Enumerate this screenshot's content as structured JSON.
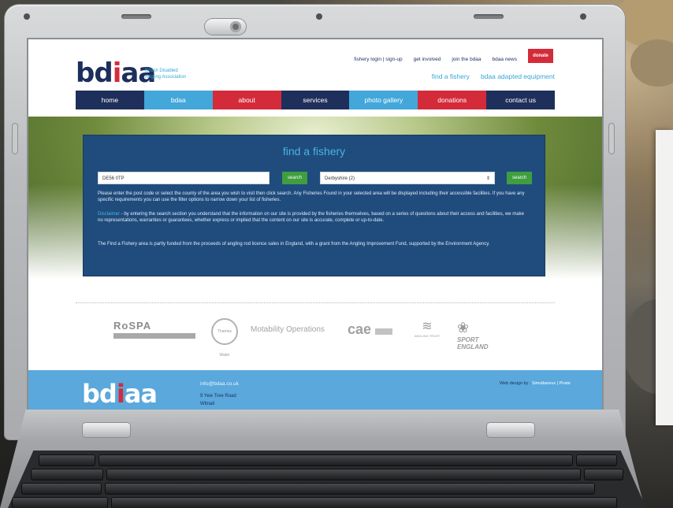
{
  "site": {
    "logo_text_pre": "bd",
    "logo_text_dot": "i",
    "logo_text_post": "aa",
    "logo_subtitle_1": "British Disabled",
    "logo_subtitle_2": "Angling Association",
    "top_links": [
      "fishery login | sign-up",
      "get involved",
      "join the bdaa",
      "bdaa news"
    ],
    "donate_label": "donate",
    "sub_links": [
      "find a fishery",
      "bdaa adapted equipment"
    ],
    "nav": [
      {
        "label": "home",
        "color": "#1f2f5b"
      },
      {
        "label": "bdaa",
        "color": "#43a7da"
      },
      {
        "label": "about",
        "color": "#d42b3a"
      },
      {
        "label": "services",
        "color": "#1f2f5b"
      },
      {
        "label": "photo gallery",
        "color": "#43a7da"
      },
      {
        "label": "donations",
        "color": "#d42b3a"
      },
      {
        "label": "contact us",
        "color": "#1f2f5b"
      }
    ]
  },
  "fishery": {
    "title": "find a fishery",
    "postcode_value": "DE56 0TP",
    "search_label": "search",
    "county_value": "Derbyshire (2)",
    "para1": "Please enter the post code or select the county of the area you wish to visit then click search. Any Fisheries Found in your selected area will be displayed including their accessible facilities. If you have any specific requirements you can use the filter options to narrow down your list of fisheries.",
    "disclaimer_label": "Disclaimer",
    "para2": " - by entering the search section you understand that the information on our site is provided by the fisheries themselves, based on a series of questions about their access and facilities, we make no representations, warranties or guarantees, whether express or implied that the content on our site is accurate, complete or up-to-date.",
    "para3": "The Find a Fishery area is partly funded from the proceeds of angling rod licence sales in England, with a grant from the Angling Improvement Fund, supported by the Environment Agency."
  },
  "sponsors": {
    "rospa": "RoSPA",
    "thames": "Thames Water",
    "motability": "Motability Operations",
    "cae": "cae",
    "angling_trust": "ANGLING TRUST",
    "sport_england_1": "SPORT",
    "sport_england_2": "ENGLAND"
  },
  "footer": {
    "logo_text_pre": "bd",
    "logo_text_dot": "i",
    "logo_text_post": "aa",
    "email": "info@bdaa.co.uk",
    "address_1": "9 Yew Tree Road",
    "address_2": "Witnall",
    "credit_prefix": "Web design by :",
    "credit_link": "Simultaneux | Pirate"
  },
  "colors": {
    "navy": "#1f2f5b",
    "light_blue": "#43a7da",
    "red": "#d42b3a",
    "box_blue": "#1f4c7d",
    "search_green": "#3f9e3f",
    "footer_blue": "#5aa8dc"
  }
}
